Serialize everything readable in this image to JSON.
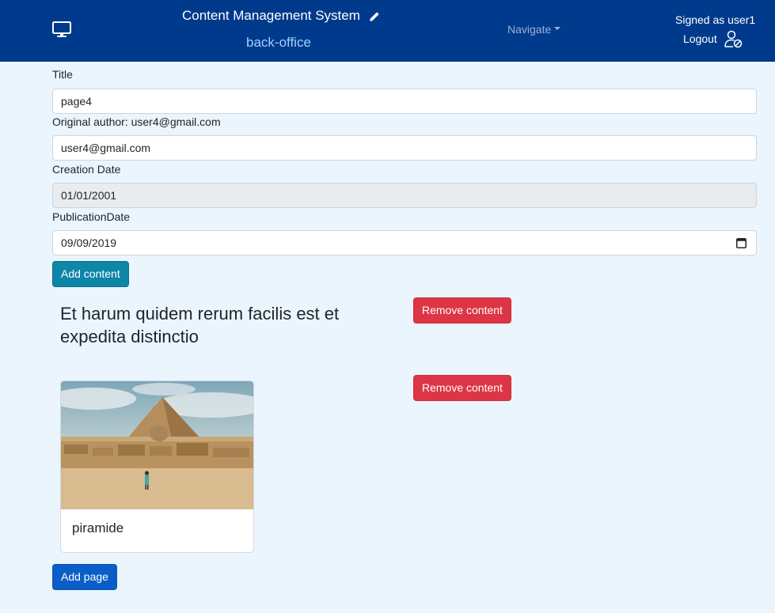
{
  "header": {
    "app_title": "Content Management System",
    "subtitle": "back-office",
    "navigate_label": "Navigate",
    "signed_as": "Signed as user1",
    "logout_label": "Logout",
    "icons": [
      "monitor-icon",
      "pencil-icon",
      "user-logout-icon"
    ]
  },
  "form": {
    "title_label": "Title",
    "title_value": "page4",
    "author_label": "Original author: user4@gmail.com",
    "author_value": "user4@gmail.com",
    "creation_label": "Creation Date",
    "creation_value": "01/01/2001",
    "publication_label": "PublicationDate",
    "publication_value": "09/09/2019",
    "add_content_label": "Add content"
  },
  "contents": [
    {
      "type": "text",
      "text": "Et harum quidem rerum facilis est et expedita distinctio",
      "remove_label": "Remove content"
    },
    {
      "type": "image-card",
      "caption": "piramide",
      "remove_label": "Remove content"
    }
  ],
  "footer": {
    "add_page_label": "Add page"
  },
  "colors": {
    "navbar": "#003a8c",
    "background": "#ebf5fd",
    "info": "#0e86a8",
    "danger": "#dc3545",
    "primary": "#0b5ec7"
  }
}
